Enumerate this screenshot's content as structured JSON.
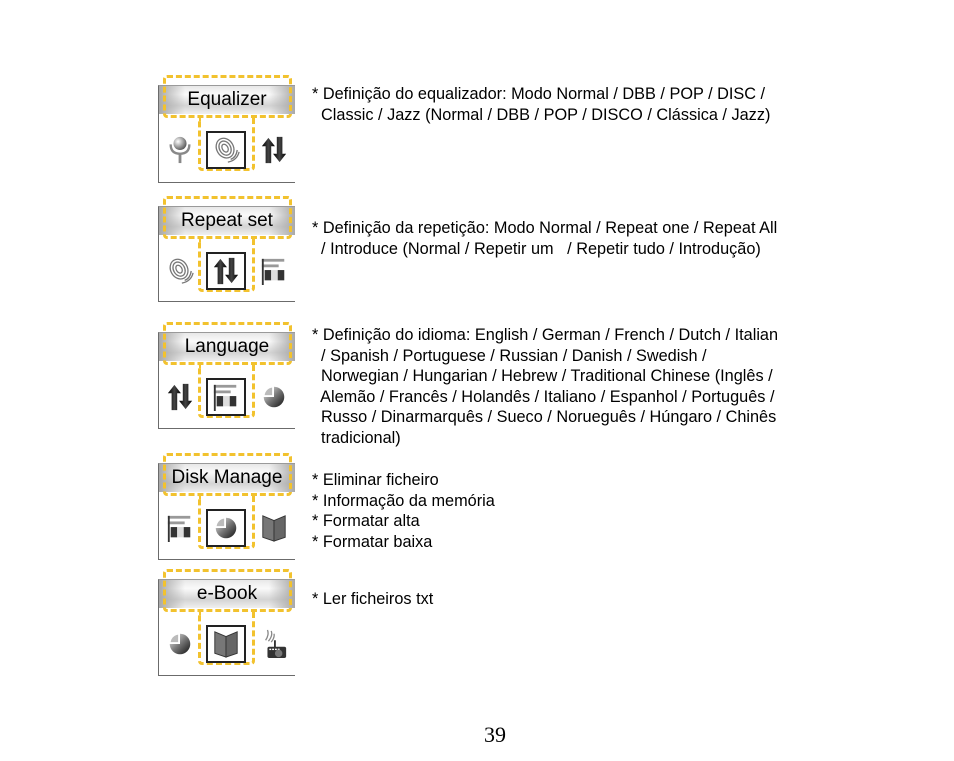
{
  "page_number": "39",
  "sections": [
    {
      "title": "Equalizer",
      "icons": {
        "left": "microphone-icon",
        "selected": "equalizer-icon",
        "right": "repeat-icon"
      },
      "lines": [
        "* Definição do equalizador: Modo Normal / DBB / POP / DISC /",
        "  Classic / Jazz (Normal / DBB / POP / DISCO / Clássica / Jazz)"
      ]
    },
    {
      "title": "Repeat set",
      "icons": {
        "left": "equalizer-icon",
        "selected": "repeat-icon",
        "right": "language-flag-icon"
      },
      "lines": [
        "* Definição da repetição: Modo Normal / Repeat one / Repeat All",
        "  / Introduce (Normal / Repetir um   / Repetir tudo / Introdução)"
      ]
    },
    {
      "title": "Language",
      "icons": {
        "left": "repeat-icon",
        "selected": "language-flag-icon",
        "right": "disk-pie-icon"
      },
      "lines": [
        "* Definição do idioma: English / German / French / Dutch / Italian",
        "  / Spanish / Portuguese / Russian / Danish / Swedish /",
        "  Norwegian / Hungarian / Hebrew / Traditional Chinese (Inglês /",
        "  Alemão / Francês / Holandês / Italiano / Espanhol / Português /",
        "  Russo / Dinarmarquês / Sueco / Norueguês / Húngaro / Chinês",
        "  tradicional)"
      ]
    },
    {
      "title": "Disk Manage",
      "icons": {
        "left": "language-flag-icon",
        "selected": "disk-pie-icon",
        "right": "book-icon"
      },
      "lines": [
        "* Eliminar ficheiro",
        "* Informação da memória",
        "* Formatar alta",
        "* Formatar baixa"
      ]
    },
    {
      "title": "e-Book",
      "icons": {
        "left": "disk-pie-icon",
        "selected": "book-icon",
        "right": "radio-icon"
      },
      "lines": [
        "* Ler ficheiros txt"
      ]
    }
  ]
}
